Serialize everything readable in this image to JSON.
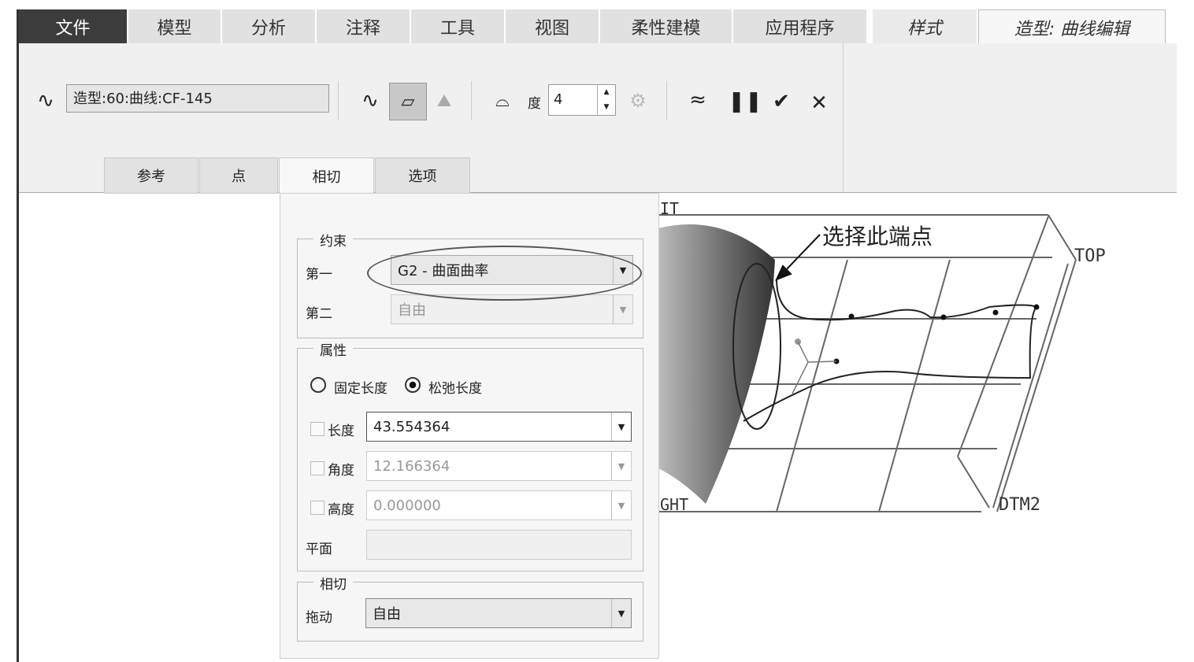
{
  "tabs": [
    "文件",
    "模型",
    "分析",
    "注释",
    "工具",
    "视图",
    "柔性建模",
    "应用程序",
    "样式",
    "造型: 曲线编辑"
  ],
  "ribbon": {
    "curve_name": "造型:60:曲线:CF-145",
    "degree_label": "度",
    "degree_value": "4"
  },
  "subtabs": [
    "参考",
    "点",
    "相切",
    "选项"
  ],
  "panel": {
    "constraint": {
      "title": "约束",
      "first_label": "第一",
      "first_value": "G2 - 曲面曲率",
      "second_label": "第二",
      "second_value": "自由"
    },
    "properties": {
      "title": "属性",
      "radio_fixed": "固定长度",
      "radio_relaxed": "松弛长度",
      "length_label": "长度",
      "length_value": "43.554364",
      "angle_label": "角度",
      "angle_value": "12.166364",
      "height_label": "高度",
      "height_value": "0.000000",
      "plane_label": "平面"
    },
    "tangent": {
      "title": "相切",
      "drag_label": "拖动",
      "drag_value": "自由"
    }
  },
  "viewport": {
    "annotation": "选择此端点",
    "label_top": "TOP",
    "label_dtm2": "DTM2",
    "label_right": "GHT",
    "label_front": "IT"
  }
}
